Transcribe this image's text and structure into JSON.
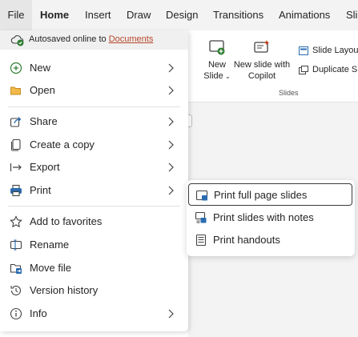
{
  "ribbon_tabs": [
    "File",
    "Home",
    "Insert",
    "Draw",
    "Design",
    "Transitions",
    "Animations",
    "Sli"
  ],
  "ribbon": {
    "new_slide_line1": "New",
    "new_slide_line2": "Slide",
    "new_slide_copilot_line1": "New slide with",
    "new_slide_copilot_line2": "Copilot",
    "slide_layout": "Slide Layou",
    "duplicate_slide": "Duplicate Sl",
    "group_label": "Slides"
  },
  "file_menu": {
    "autosave_text": "Autosaved online to",
    "autosave_link": "Documents",
    "items": {
      "new": "New",
      "open": "Open",
      "share": "Share",
      "create_copy": "Create a copy",
      "export": "Export",
      "print": "Print",
      "add_favorites": "Add to favorites",
      "rename": "Rename",
      "move_file": "Move file",
      "version_history": "Version history",
      "info": "Info"
    }
  },
  "print_submenu": {
    "items": [
      "Print full page slides",
      "Print slides with notes",
      "Print handouts"
    ]
  },
  "colors": {
    "accent_link": "#b7472a",
    "autosave_check": "#2e7d32",
    "powerpoint_orange": "#c43e1c",
    "icon_blue": "#2b6cb0"
  }
}
